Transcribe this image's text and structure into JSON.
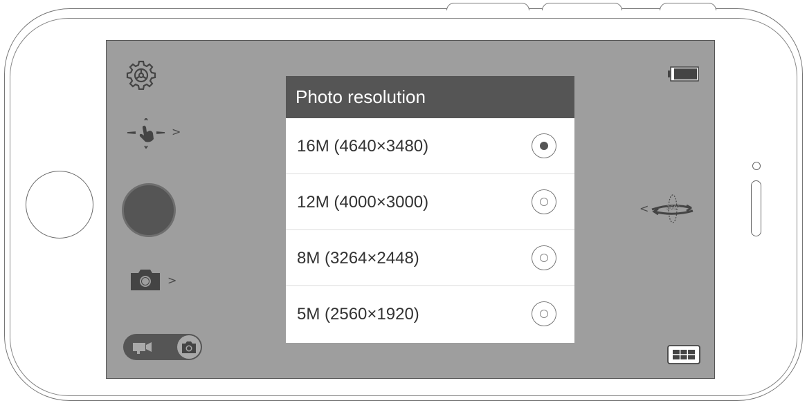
{
  "dialog": {
    "title": "Photo resolution",
    "options": [
      {
        "label": "16M (4640×3480)",
        "selected": true
      },
      {
        "label": "12M (4000×3000)",
        "selected": false
      },
      {
        "label": "8M (3264×2448)",
        "selected": false
      },
      {
        "label": "5M (2560×1920)",
        "selected": false
      }
    ]
  },
  "left_controls": {
    "settings_icon": "gear-icon",
    "gesture_icon": "swipe-gesture-icon",
    "gesture_chevron": ">",
    "shutter_icon": "shutter-button",
    "camera_icon": "camera-icon",
    "camera_chevron": ">",
    "mode_toggle_icons": [
      "video-camera-icon",
      "camera-icon"
    ],
    "mode_selected": "photo"
  },
  "right_controls": {
    "battery_icon": "battery-icon",
    "rotate_360_icon": "rotate-360-icon",
    "rotate_360_text": "360°",
    "rotate_chevron": "<",
    "grid_icon": "grid-icon"
  },
  "colors": {
    "screen_bg": "#9e9e9e",
    "dialog_header_bg": "#555555",
    "dialog_bg": "#ffffff",
    "control_dark": "#555555"
  }
}
